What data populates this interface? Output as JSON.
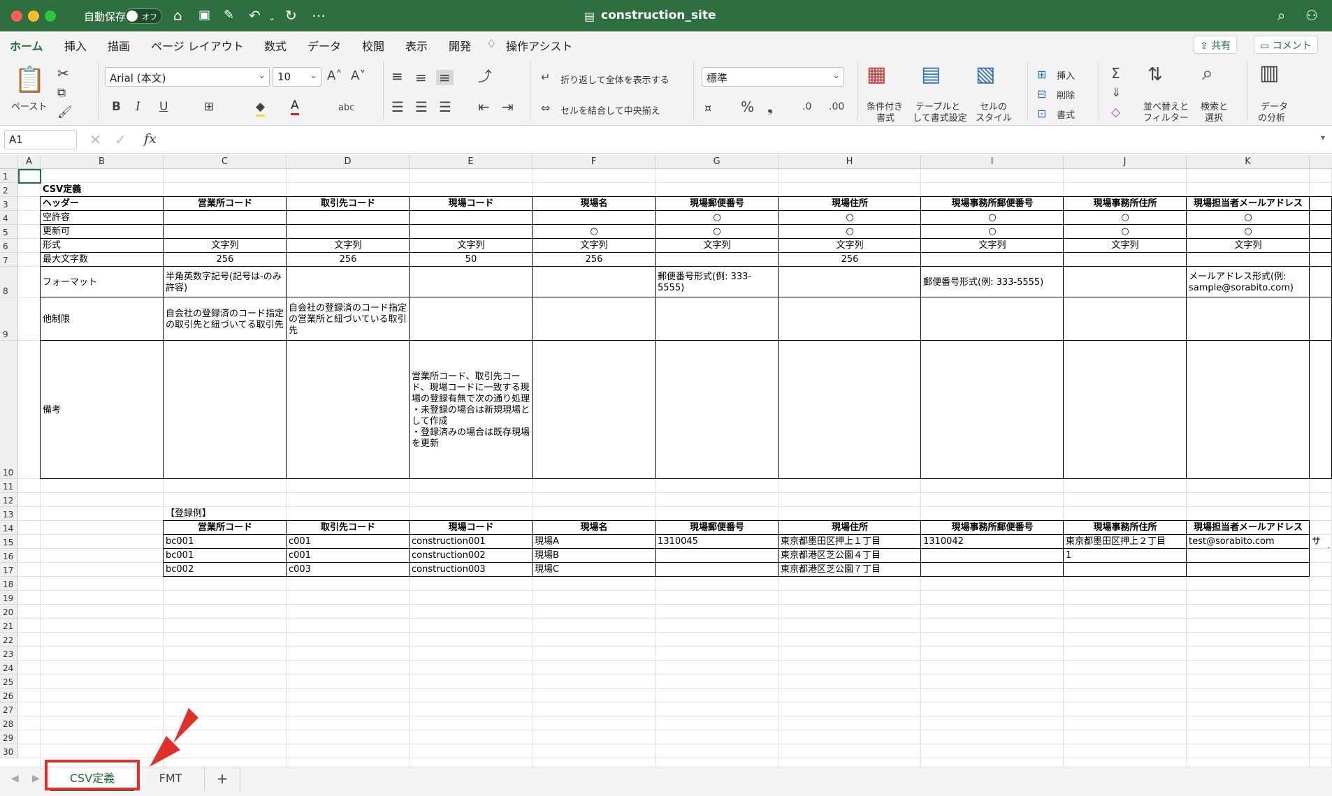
{
  "titlebar": {
    "autosave_label": "自動保存",
    "autosave_state": "オフ",
    "doc_title": "construction_site"
  },
  "menu_tabs": [
    "ホーム",
    "挿入",
    "描画",
    "ページ レイアウト",
    "数式",
    "データ",
    "校閲",
    "表示",
    "開発",
    "操作アシスト"
  ],
  "share": {
    "share_label": "共有",
    "comment_label": "コメント"
  },
  "ribbon": {
    "paste_label": "ペースト",
    "font_name": "Arial (本文)",
    "font_size": "10",
    "wrap_label": "折り返して全体を表示する",
    "merge_label": "セルを結合して中央揃え",
    "number_format": "標準",
    "cond_format_l1": "条件付き",
    "cond_format_l2": "書式",
    "table_l1": "テーブルと",
    "table_l2": "して書式設定",
    "cell_style_l1": "セルの",
    "cell_style_l2": "スタイル",
    "insert_label": "挿入",
    "delete_label": "削除",
    "format_label": "書式",
    "sort_l1": "並べ替えと",
    "sort_l2": "フィルター",
    "find_l1": "検索と",
    "find_l2": "選択",
    "analyze_l1": "データ",
    "analyze_l2": "の分析"
  },
  "formula_bar": {
    "name_box": "A1",
    "fx": "fx"
  },
  "columns": [
    "A",
    "B",
    "C",
    "D",
    "E",
    "F",
    "G",
    "H",
    "I",
    "J",
    "K"
  ],
  "row_numbers": [
    "1",
    "2",
    "3",
    "4",
    "5",
    "6",
    "7",
    "8",
    "9",
    "10",
    "11",
    "12",
    "13",
    "14",
    "15",
    "16",
    "17",
    "18",
    "19",
    "20",
    "21",
    "22",
    "23",
    "24",
    "25",
    "26",
    "27",
    "28",
    "29",
    "30"
  ],
  "sheet": {
    "b2": "CSV定義",
    "headers_title": "ヘッダー",
    "headers": [
      "営業所コード",
      "取引先コード",
      "現場コード",
      "現場名",
      "現場郵便番号",
      "現場住所",
      "現場事務所郵便番号",
      "現場事務所住所",
      "現場担当者メールアドレス"
    ],
    "row_labels": [
      "空許容",
      "更新可",
      "形式",
      "最大文字数",
      "フォーマット",
      "他制限",
      "備考"
    ],
    "empty_ok": [
      "",
      "",
      "",
      "",
      "○",
      "○",
      "○",
      "○",
      "○"
    ],
    "updatable": [
      "",
      "",
      "",
      "○",
      "○",
      "○",
      "○",
      "○",
      "○"
    ],
    "format": [
      "文字列",
      "文字列",
      "文字列",
      "文字列",
      "文字列",
      "文字列",
      "文字列",
      "文字列",
      "文字列"
    ],
    "max_len": [
      "256",
      "256",
      "50",
      "256",
      "",
      "256",
      "",
      "",
      ""
    ],
    "fmt_c": "半角英数字記号(記号は-のみ許容)",
    "fmt_g": "郵便番号形式(例: 333-5555)",
    "fmt_i": "郵便番号形式(例: 333-5555)",
    "fmt_k": "メールアドレス形式(例: sample@sorabito.com)",
    "limit_c": "自会社の登録済のコード指定の取引先と紐づいてる取引先",
    "limit_d": "自会社の登録済のコード指定の営業所と紐づいている取引先",
    "note_e": "営業所コード、取引先コード、現場コードに一致する現場の登録有無で次の通り処理\n・未登録の場合は新規現場として作成\n・登録済みの場合は既存現場を更新",
    "example_title": "【登録例】",
    "example_rows": [
      [
        "bc001",
        "c001",
        "construction001",
        "現場A",
        "1310045",
        "東京都墨田区押上１丁目",
        "1310042",
        "東京都墨田区押上２丁目",
        "test@sorabito.com",
        "サンプ"
      ],
      [
        "bc001",
        "c001",
        "construction002",
        "現場B",
        "",
        "東京都港区芝公園４丁目",
        "",
        "1",
        "",
        ""
      ],
      [
        "bc002",
        "c003",
        "construction003",
        "現場C",
        "",
        "東京都港区芝公園７丁目",
        "",
        "",
        "",
        ""
      ]
    ]
  },
  "sheet_tabs": [
    "CSV定義",
    "FMT"
  ],
  "add_sheet": "+",
  "colors": {
    "excel_green": "#2e6f3f",
    "highlight_red": "#e0302a"
  }
}
